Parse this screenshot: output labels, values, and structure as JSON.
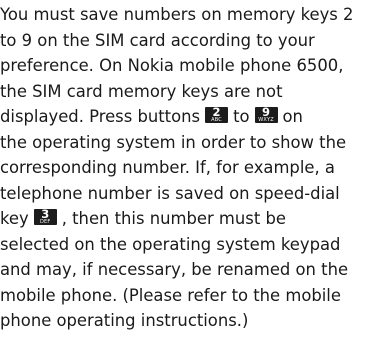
{
  "paragraph": {
    "line1": "You must save numbers on memory keys 2",
    "line2": "to 9 on the SIM card according to your",
    "line3": "preference. On Nokia mobile phone 6500,",
    "line4": "the SIM card memory keys are not",
    "line5_pre": "displayed. Press buttons",
    "line5_mid": "to",
    "line5_post": "on",
    "line6": "the operating system in order to show the",
    "line7": "corresponding number. If, for example, a",
    "line8": "telephone number is saved on speed-dial",
    "line9_pre": "key",
    "line9_post": ", then this number must be",
    "line10": "selected on the operating system keypad",
    "line11": "and may, if necessary, be renamed on the",
    "line12": "mobile phone. (Please refer to the mobile",
    "line13": "phone operating instructions.)"
  },
  "keys": {
    "key2": {
      "number": "2",
      "letters": "ABC",
      "icon": "keypad-key-2-icon"
    },
    "key9": {
      "number": "9",
      "letters": "WXYZ",
      "icon": "keypad-key-9-icon"
    },
    "key3": {
      "number": "3",
      "letters": "DEF",
      "icon": "keypad-key-3-icon"
    }
  },
  "colors": {
    "text": "#1a1a1a",
    "key_background": "#1c1c1c",
    "key_text": "#ffffff"
  }
}
